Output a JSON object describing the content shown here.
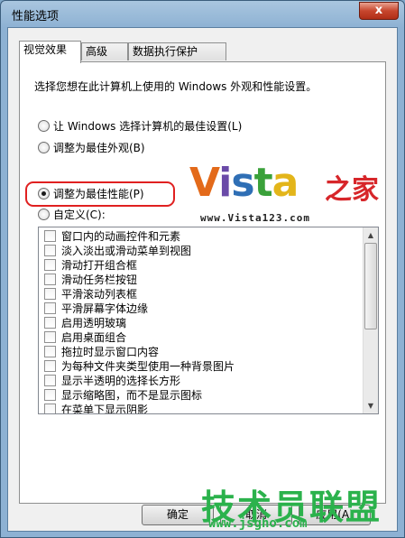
{
  "window": {
    "title": "性能选项",
    "close_label": "x"
  },
  "tabs": [
    {
      "label": "视觉效果",
      "active": true
    },
    {
      "label": "高级",
      "active": false
    },
    {
      "label": "数据执行保护",
      "active": false
    }
  ],
  "description": "选择您想在此计算机上使用的 Windows 外观和性能设置。",
  "radios": [
    {
      "label": "让 Windows 选择计算机的最佳设置(L)",
      "checked": false
    },
    {
      "label": "调整为最佳外观(B)",
      "checked": false
    },
    {
      "label": "调整为最佳性能(P)",
      "checked": true
    },
    {
      "label": "自定义(C):",
      "checked": false
    }
  ],
  "effects": [
    "窗口内的动画控件和元素",
    "淡入淡出或滑动菜单到视图",
    "滑动打开组合框",
    "滑动任务栏按钮",
    "平滑滚动列表框",
    "平滑屏幕字体边缘",
    "启用透明玻璃",
    "启用桌面组合",
    "拖拉时显示窗口内容",
    "为每种文件夹类型使用一种背景图片",
    "显示半透明的选择长方形",
    "显示缩略图，而不是显示图标",
    "在菜单下显示阴影"
  ],
  "buttons": {
    "ok": "确定",
    "cancel": "取消",
    "apply": "应用(A)"
  },
  "logo": {
    "vista": "Vista",
    "vista_cn": "之家",
    "vista_url": "www.Vista123.com"
  },
  "watermark": {
    "text": "技术员联盟",
    "url": "www.jsgho.com"
  },
  "colors": {
    "highlight": "#e02020",
    "watermark": "#2bb24c"
  }
}
